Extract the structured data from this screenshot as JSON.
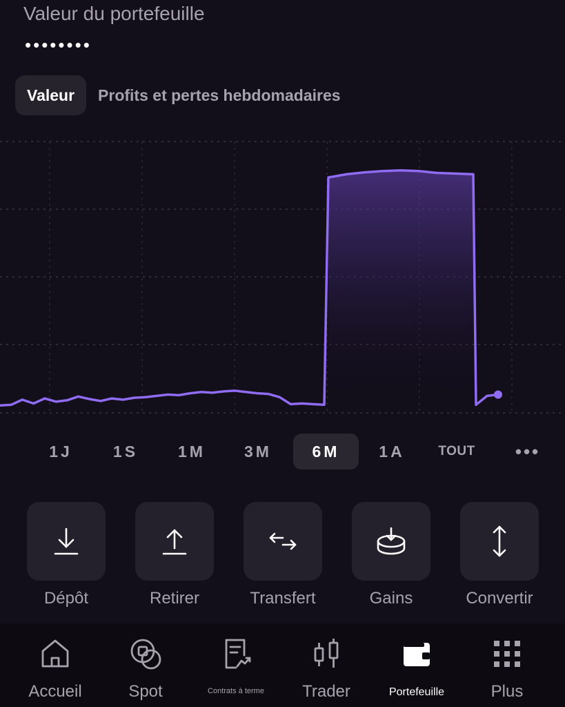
{
  "header": {
    "title": "Valeur du portefeuille",
    "masked_value": "••••••••"
  },
  "view_tabs": [
    {
      "label": "Valeur",
      "active": true
    },
    {
      "label": "Profits et pertes hebdomadaires",
      "active": false
    }
  ],
  "time_ranges": [
    {
      "label": "1J",
      "active": false
    },
    {
      "label": "1S",
      "active": false
    },
    {
      "label": "1M",
      "active": false
    },
    {
      "label": "3M",
      "active": false
    },
    {
      "label": "6M",
      "active": true
    },
    {
      "label": "1A",
      "active": false
    },
    {
      "label": "TOUT",
      "active": false
    },
    {
      "label": "•••",
      "active": false
    }
  ],
  "actions": [
    {
      "label": "Dépôt",
      "icon": "deposit-icon"
    },
    {
      "label": "Retirer",
      "icon": "withdraw-icon"
    },
    {
      "label": "Transfert",
      "icon": "transfer-icon"
    },
    {
      "label": "Gains",
      "icon": "earn-icon"
    },
    {
      "label": "Convertir",
      "icon": "convert-icon"
    }
  ],
  "nav": [
    {
      "label": "Accueil",
      "icon": "home-icon",
      "active": false
    },
    {
      "label": "Spot",
      "icon": "coins-icon",
      "active": false
    },
    {
      "label": "Contrats à terme",
      "icon": "futures-icon",
      "active": false
    },
    {
      "label": "Trader",
      "icon": "candlestick-icon",
      "active": false
    },
    {
      "label": "Portefeuille",
      "icon": "wallet-icon",
      "active": true
    },
    {
      "label": "Plus",
      "icon": "grid-icon",
      "active": false
    }
  ],
  "colors": {
    "background": "#120e1a",
    "line": "#8f6cf2",
    "text_muted": "#a7a3ad"
  },
  "chart_data": {
    "type": "area",
    "note_values": "relative portfolio value over 6 months (y axis unlabeled)",
    "values": [
      3,
      4,
      12,
      6,
      14,
      9,
      11,
      17,
      13,
      10,
      14,
      12,
      15,
      16,
      18,
      20,
      19,
      22,
      24,
      23,
      25,
      26,
      24,
      22,
      21,
      16,
      5,
      6,
      5,
      4,
      360,
      365,
      368,
      370,
      371,
      370,
      367,
      366,
      365,
      4,
      18,
      20
    ],
    "ylim": [
      0,
      400
    ],
    "grid": true
  }
}
